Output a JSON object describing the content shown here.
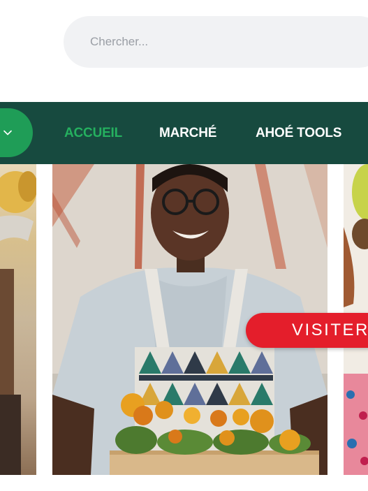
{
  "search": {
    "placeholder": "Chercher..."
  },
  "nav": {
    "items": [
      {
        "label": "ACCUEIL",
        "active": true
      },
      {
        "label": "MARCHÉ",
        "active": false
      },
      {
        "label": "AHOÉ TOOLS",
        "active": false
      }
    ],
    "toggle_icon": "chevron-down-icon"
  },
  "hero": {
    "visit_label": "VISITER"
  },
  "colors": {
    "nav_background": "#174a3f",
    "accent_green": "#1f9d57",
    "active_text": "#25b05f",
    "visit_button": "#e41e2b",
    "search_background": "#f1f2f4"
  }
}
